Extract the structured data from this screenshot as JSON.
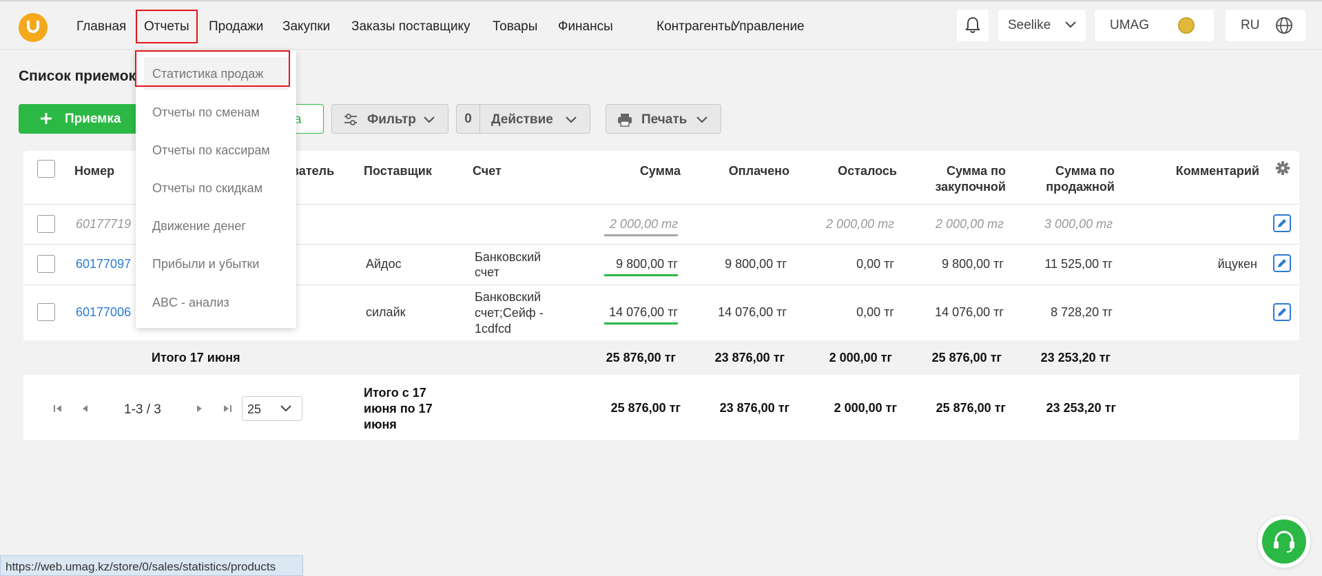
{
  "nav": {
    "items": [
      "Главная",
      "Отчеты",
      "Продажи",
      "Закупки",
      "Заказы поставщику",
      "Товары",
      "Финансы",
      "Контрагенты",
      "Управление"
    ],
    "active": "Отчеты"
  },
  "header": {
    "store": "Seelike",
    "account": "UMAG",
    "language": "RU"
  },
  "page": {
    "title": "Список приемок"
  },
  "toolbar": {
    "add_label": "Приемка",
    "filter_label": "Фильтр",
    "action_count": "0",
    "action_label": "Действие",
    "print_label": "Печать",
    "partial_green_text": "а"
  },
  "table": {
    "columns": [
      "Номер",
      "ователь",
      "Поставщик",
      "Счет",
      "Сумма",
      "Оплачено",
      "Осталось",
      "Сумма по закупочной",
      "Сумма по продажной",
      "Комментарий"
    ],
    "rows": [
      {
        "number": "60177719",
        "supplier": "",
        "account": "",
        "sum": "2 000,00 тг",
        "paid": "",
        "left": "2 000,00 тг",
        "purchase": "2 000,00 тг",
        "sale": "3 000,00 тг",
        "comment": "",
        "status_color": "#a6a6a6"
      },
      {
        "number": "60177097",
        "supplier": "Айдос",
        "account": "Банковский счет",
        "sum": "9 800,00 тг",
        "paid": "9 800,00 тг",
        "left": "0,00 тг",
        "purchase": "9 800,00 тг",
        "sale": "11 525,00 тг",
        "comment": "йцукен",
        "status_color": "#2cb845"
      },
      {
        "number": "60177006",
        "supplier": "силайк",
        "account": "Банковский счет;Сейф - 1cdfcd",
        "sum": "14 076,00 тг",
        "paid": "14 076,00 тг",
        "left": "0,00 тг",
        "purchase": "14 076,00 тг",
        "sale": "8 728,20 тг",
        "comment": "",
        "status_color": "#2cb845"
      }
    ],
    "day_total": {
      "label": "Итого 17 июня",
      "sum": "25 876,00 тг",
      "paid": "23 876,00 тг",
      "left": "2 000,00 тг",
      "purchase": "25 876,00 тг",
      "sale": "23 253,20 тг"
    },
    "period_total": {
      "label": "Итого с 17 июня по 17 июня",
      "sum": "25 876,00 тг",
      "paid": "23 876,00 тг",
      "left": "2 000,00 тг",
      "purchase": "25 876,00 тг",
      "sale": "23 253,20 тг"
    }
  },
  "pagination": {
    "range": "1-3 / 3",
    "page_size": "25"
  },
  "reports_menu": {
    "items": [
      "Статистика продаж",
      "Отчеты по сменам",
      "Отчеты по кассирам",
      "Отчеты по скидкам",
      "Движение денег",
      "Прибыли и убытки",
      "ABC - анализ"
    ],
    "highlighted": "Статистика продаж"
  },
  "statusbar": {
    "url": "https://web.umag.kz/store/0/sales/statistics/products"
  },
  "colors": {
    "accent_green": "#2cb845",
    "link_blue": "#2a7bd6",
    "highlight_red": "#e3151a",
    "logo_orange": "#f4a81b"
  }
}
